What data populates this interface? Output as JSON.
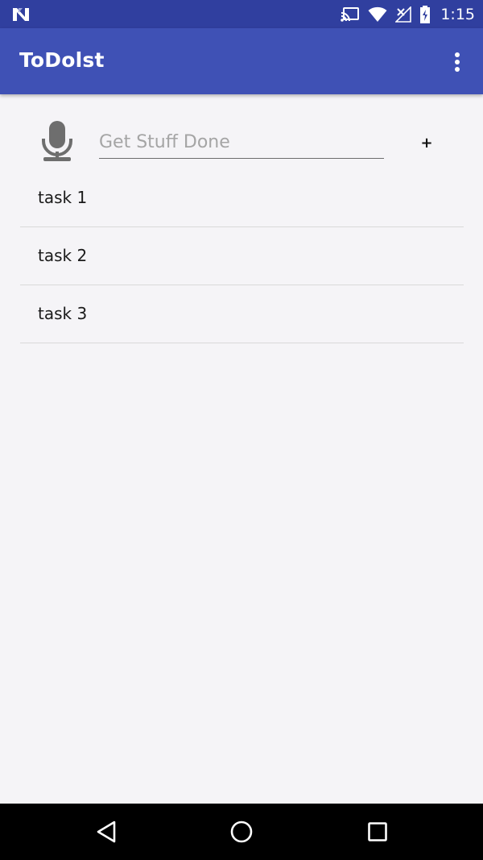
{
  "status_bar": {
    "time": "1:15",
    "icons": [
      "notification-n-icon",
      "cast-icon",
      "wifi-icon",
      "no-signal-icon",
      "battery-charging-icon"
    ]
  },
  "app_bar": {
    "title": "ToDolst",
    "menu_icon": "overflow-menu-icon"
  },
  "input": {
    "placeholder": "Get Stuff Done",
    "value": "",
    "mic_icon": "microphone-icon",
    "add_label": "+"
  },
  "tasks": [
    {
      "label": "task 1"
    },
    {
      "label": "task 2"
    },
    {
      "label": "task 3"
    }
  ],
  "nav_bar": {
    "icons": [
      "back-icon",
      "home-icon",
      "recents-icon"
    ]
  },
  "colors": {
    "status_bar": "#303f9f",
    "app_bar": "#3f51b5",
    "background": "#f5f4f7"
  }
}
